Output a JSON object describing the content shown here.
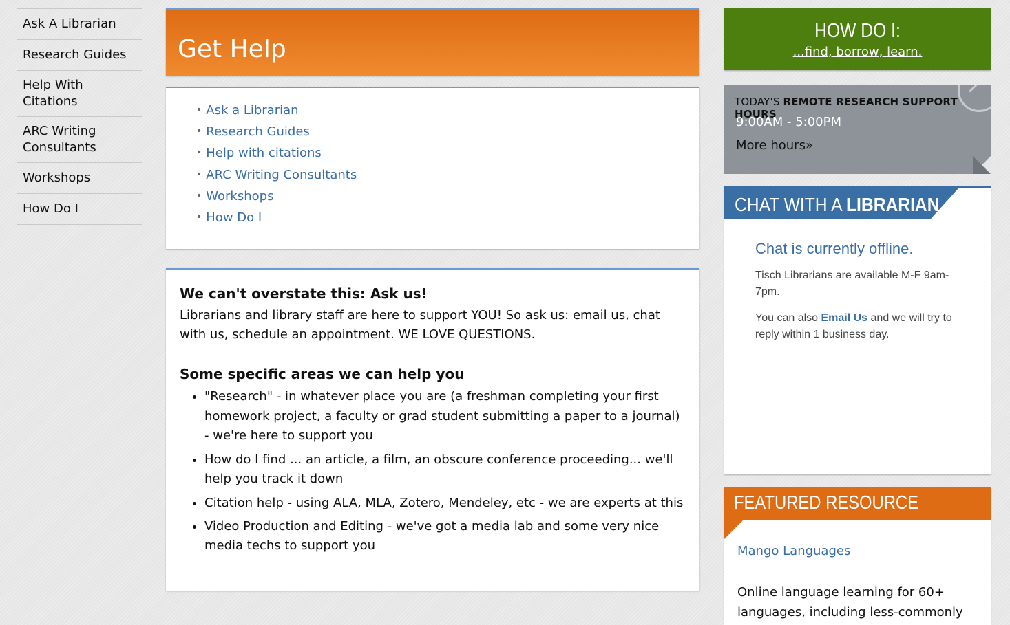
{
  "left_nav": {
    "items": [
      "Ask A Librarian",
      "Research Guides",
      "Help With Citations",
      "ARC Writing Consultants",
      "Workshops",
      "How Do I"
    ]
  },
  "page": {
    "title": "Get Help"
  },
  "quick_links": [
    "Ask a Librarian",
    "Research Guides",
    "Help with citations",
    "ARC Writing Consultants",
    "Workshops",
    "How Do I"
  ],
  "content": {
    "heading1": "We can't overstate this: Ask us!",
    "intro": "Librarians and library staff are here to support YOU! So ask us: email us, chat with us, schedule an appointment. WE LOVE QUESTIONS.",
    "heading2": "Some specific areas we can help you",
    "bullets": [
      "\"Research\" - in whatever place you are (a freshman completing your first homework project, a faculty or grad student submitting a paper to a journal) - we're here to support you",
      "How do I find ... an article, a film, an obscure conference proceeding... we'll help you track it down",
      "Citation help - using ALA, MLA, Zotero, Mendeley, etc - we are experts at this",
      "Video Production and Editing - we've got a media lab and some very nice media techs to support you"
    ]
  },
  "how_do_i": {
    "title": "HOW DO I:",
    "link": "...find, borrow, learn."
  },
  "hours": {
    "label_prefix": "TODAY'S",
    "label_bold": "REMOTE RESEARCH SUPPORT HOURS",
    "time": "9:00AM - 5:00PM",
    "more": "More hours»"
  },
  "chat": {
    "title_light": "CHAT WITH A ",
    "title_bold": "LIBRARIAN",
    "status": "Chat is currently offline.",
    "availability": "Tisch Librarians are available M-F 9am-7pm.",
    "email_prefix": "You can also ",
    "email_link": "Email Us",
    "email_suffix": " and we will try to reply within 1 business day."
  },
  "featured": {
    "title": "FEATURED RESOURCE",
    "link": "Mango Languages",
    "description": "Online language learning for 60+ languages, including less-commonly"
  },
  "colors": {
    "orange": "#de6c15",
    "green": "#4c7f0d",
    "blue": "#3a6fa5",
    "gray": "#8d9399"
  }
}
